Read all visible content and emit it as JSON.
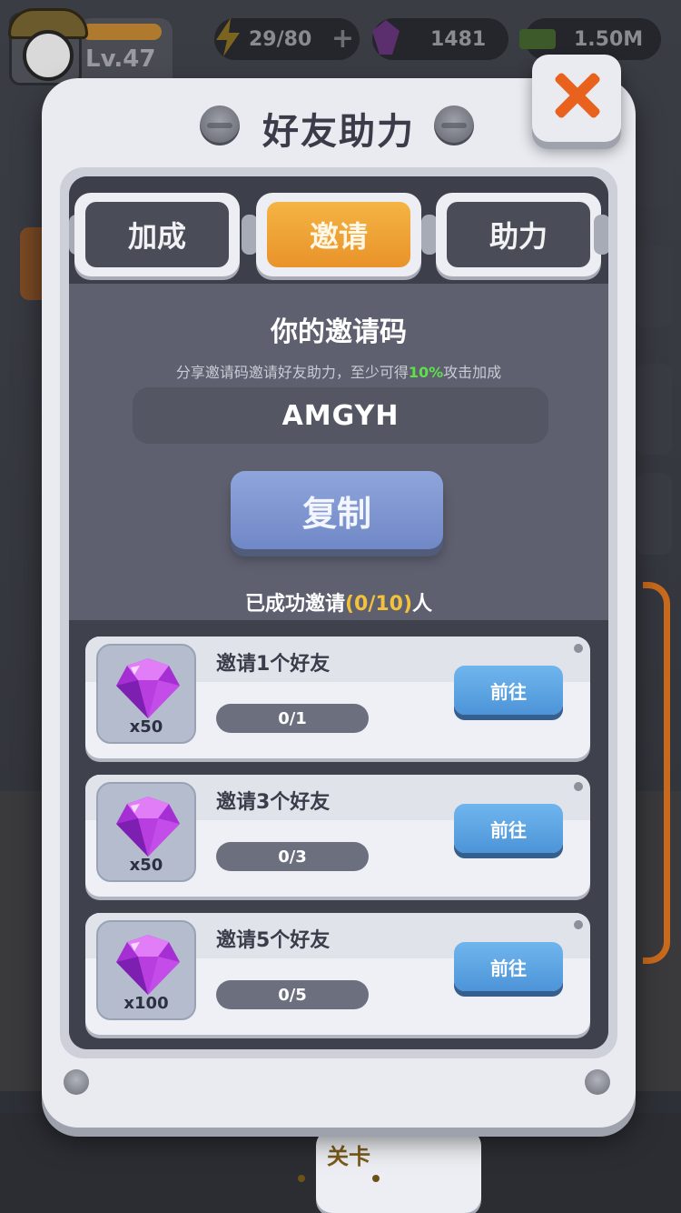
{
  "hud": {
    "level": "Lv.47",
    "energy": "29/80",
    "gems": "1481",
    "cash": "1.50M"
  },
  "bottom_nav": {
    "active_tab": "关卡"
  },
  "modal": {
    "title": "好友助力",
    "tabs": [
      {
        "label": "加成",
        "active": false
      },
      {
        "label": "邀请",
        "active": true
      },
      {
        "label": "助力",
        "active": false
      }
    ],
    "code_title": "你的邀请码",
    "code_desc_prefix": "分享邀请码邀请好友助力，至少可得",
    "code_desc_highlight": "10%",
    "code_desc_suffix": "攻击加成",
    "invite_code": "AMGYH",
    "copy_label": "复制",
    "success_prefix": "已成功邀请",
    "success_count": "(0/10)",
    "success_suffix": "人",
    "rewards": [
      {
        "name": "邀请1个好友",
        "qty": "x50",
        "progress": "0/1",
        "progress_fraction": 0,
        "button": "前往",
        "icon": "purple-gem-icon"
      },
      {
        "name": "邀请3个好友",
        "qty": "x50",
        "progress": "0/3",
        "progress_fraction": 0,
        "button": "前往",
        "icon": "purple-gem-icon"
      },
      {
        "name": "邀请5个好友",
        "qty": "x100",
        "progress": "0/5",
        "progress_fraction": 0,
        "button": "前往",
        "icon": "purple-gem-icon"
      }
    ]
  },
  "colors": {
    "accent_orange": "#e9932a",
    "highlight_green": "#5fe04a",
    "highlight_yellow": "#f3c23c",
    "go_button_blue": "#4d94d8",
    "close_x": "#e8621d"
  }
}
